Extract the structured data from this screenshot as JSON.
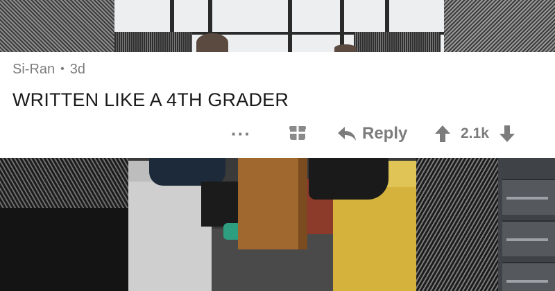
{
  "comment": {
    "author": "Si-Ran",
    "separator": "•",
    "age": "3d",
    "body": "WRITTEN LIKE A 4TH GRADER",
    "more_label": "···",
    "reply_label": "Reply",
    "score": "2.1k"
  },
  "icons": {
    "more": "more-options-icon",
    "gift": "gift-award-icon",
    "reply": "reply-arrow-icon",
    "upvote": "upvote-arrow-icon",
    "downvote": "downvote-arrow-icon"
  },
  "colors": {
    "card_bg": "#ffffff",
    "meta_text": "#7c7c7c",
    "body_text": "#1a1a1b",
    "action_text": "#7c7c7c"
  }
}
